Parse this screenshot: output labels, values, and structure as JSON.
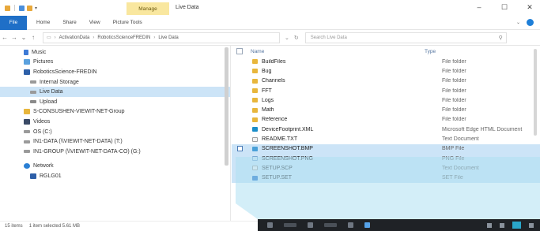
{
  "ribbon": {
    "manage_label": "Manage",
    "window_title": "Live Data",
    "tabs": [
      "Home",
      "Share",
      "View",
      "Picture Tools"
    ],
    "file_label": "File"
  },
  "address": {
    "crumbs": [
      "ActivationData",
      "RoboticsScienceFREDIN",
      "Live Data"
    ],
    "search_placeholder": "Search Live Data"
  },
  "nav": {
    "items": [
      {
        "label": "Music",
        "icon": "music-icon",
        "level": 0,
        "state": ""
      },
      {
        "label": "Pictures",
        "icon": "pictures-icon",
        "level": 0,
        "state": ""
      },
      {
        "label": "RoboticsScience-FREDIN",
        "icon": "computer-icon",
        "level": 0,
        "state": ""
      },
      {
        "label": "Internal Storage",
        "icon": "drive-icon",
        "level": 1,
        "state": ""
      },
      {
        "label": "Live Data",
        "icon": "drive-icon",
        "level": 1,
        "state": "selected"
      },
      {
        "label": "Upload",
        "icon": "upload-icon",
        "level": 1,
        "state": ""
      },
      {
        "label": "S-CONSUSHEN-VIEWIT-NET-Group",
        "icon": "folder-icon",
        "level": 0,
        "state": ""
      },
      {
        "label": "Videos",
        "icon": "videos-icon",
        "level": 0,
        "state": ""
      },
      {
        "label": "OS (C:)",
        "icon": "drive-icon",
        "level": 0,
        "state": ""
      },
      {
        "label": "IN1-DATA (\\\\VIEWIT-NET-DATA) (T:)",
        "icon": "network-drive-icon",
        "level": 0,
        "state": ""
      },
      {
        "label": "IN1-GROUP (\\\\VIEWIT-NET-DATA-CO) (G:)",
        "icon": "network-drive-icon",
        "level": 0,
        "state": ""
      },
      {
        "label": "Network",
        "icon": "network-icon",
        "level": 0,
        "state": ""
      },
      {
        "label": "RGLG01",
        "icon": "computer-icon",
        "level": 1,
        "state": ""
      }
    ]
  },
  "main": {
    "columns": {
      "name": "Name",
      "type": "Type"
    },
    "files": [
      {
        "name": "BuildFiles",
        "type": "File folder",
        "icon": "folder-icon",
        "selected": false
      },
      {
        "name": "Bug",
        "type": "File folder",
        "icon": "folder-icon",
        "selected": false
      },
      {
        "name": "Channels",
        "type": "File folder",
        "icon": "folder-icon",
        "selected": false
      },
      {
        "name": "FFT",
        "type": "File folder",
        "icon": "folder-icon",
        "selected": false
      },
      {
        "name": "Logs",
        "type": "File folder",
        "icon": "folder-icon",
        "selected": false
      },
      {
        "name": "Math",
        "type": "File folder",
        "icon": "folder-icon",
        "selected": false
      },
      {
        "name": "Reference",
        "type": "File folder",
        "icon": "folder-icon",
        "selected": false
      },
      {
        "name": "DeviceFootprint.XML",
        "type": "Microsoft Edge HTML Document",
        "icon": "edge-icon",
        "selected": false
      },
      {
        "name": "README.TXT",
        "type": "Text Document",
        "icon": "text-file-icon",
        "selected": false
      },
      {
        "name": "SCREENSHOT.BMP",
        "type": "BMP File",
        "icon": "bmp-icon",
        "selected": true
      },
      {
        "name": "SCREENSHOT.PNG",
        "type": "PNG File",
        "icon": "png-icon",
        "selected": true
      },
      {
        "name": "SETUP.SCP",
        "type": "Text Document",
        "icon": "text-file-icon",
        "selected": true
      },
      {
        "name": "SETUP.SET",
        "type": "SET File",
        "icon": "sif-icon",
        "selected": true
      }
    ],
    "status": {
      "items_count": "15 items",
      "selected_info": "1 item selected  5.61 MB"
    }
  },
  "colors": {
    "accent": "#1f6fc7",
    "manage_tab": "#f9e79f",
    "selection": "#cce4f7",
    "overlay": "#aee0f2",
    "taskbar": "#1f2226"
  }
}
